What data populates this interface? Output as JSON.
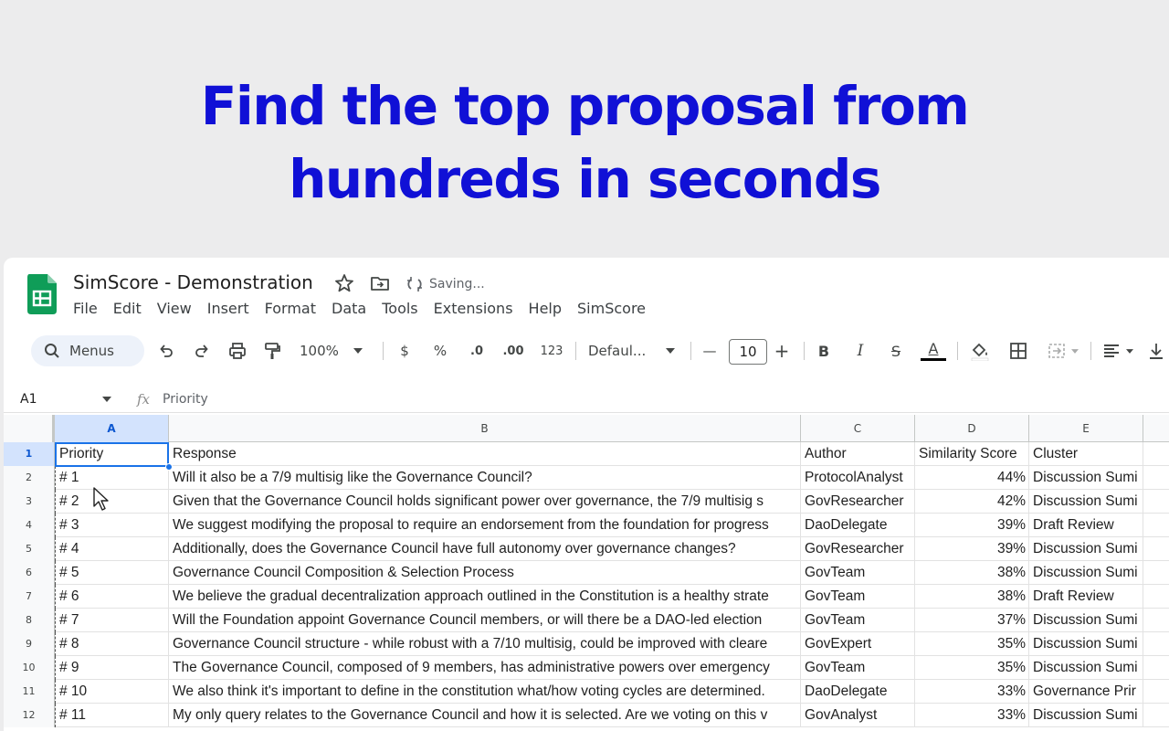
{
  "hero": {
    "line1": "Find the top proposal from",
    "line2": "hundreds in seconds"
  },
  "app": {
    "title": "SimScore - Demonstration",
    "saving_status": "Saving...",
    "icons": [
      "sheets-logo-icon",
      "star-icon",
      "move-to-folder-icon",
      "sync-icon"
    ],
    "menu": [
      "File",
      "Edit",
      "View",
      "Insert",
      "Format",
      "Data",
      "Tools",
      "Extensions",
      "Help",
      "SimScore"
    ]
  },
  "toolbar": {
    "search_label": "Menus",
    "zoom": "100%",
    "currency": "$",
    "percent": "%",
    "decrease_decimal": ".0",
    "increase_decimal": ".00",
    "number_format": "123",
    "font": "Defaul...",
    "font_size": "10",
    "minus": "—",
    "plus": "+",
    "bold": "B",
    "italic": "I",
    "strikethrough": "S",
    "text_color": "A"
  },
  "formula_bar": {
    "cell_ref": "A1",
    "fx": "fx",
    "value": "Priority"
  },
  "columns": [
    "A",
    "B",
    "C",
    "D",
    "E"
  ],
  "rows": [
    {
      "num": "1",
      "priority": "Priority",
      "response": "Response",
      "author": "Author",
      "score": "Similarity Score",
      "cluster": "Cluster"
    },
    {
      "num": "2",
      "priority": "# 1",
      "response": "Will it also be a 7/9 multisig like the Governance Council?",
      "author": "ProtocolAnalyst",
      "score": "44%",
      "cluster": "Discussion Sumi"
    },
    {
      "num": "3",
      "priority": "# 2",
      "response": "Given that the Governance Council holds significant power over governance, the 7/9 multisig s",
      "author": "GovResearcher",
      "score": "42%",
      "cluster": "Discussion Sumi"
    },
    {
      "num": "4",
      "priority": "# 3",
      "response": "We suggest modifying the proposal to require an endorsement from the foundation for progress",
      "author": "DaoDelegate",
      "score": "39%",
      "cluster": "Draft Review"
    },
    {
      "num": "5",
      "priority": "# 4",
      "response": "Additionally, does the Governance Council have full autonomy over governance changes?",
      "author": "GovResearcher",
      "score": "39%",
      "cluster": "Discussion Sumi"
    },
    {
      "num": "6",
      "priority": "# 5",
      "response": "Governance Council Composition & Selection Process",
      "author": "GovTeam",
      "score": "38%",
      "cluster": "Discussion Sumi"
    },
    {
      "num": "7",
      "priority": "# 6",
      "response": "We believe the gradual decentralization approach outlined in the Constitution is a healthy strate",
      "author": "GovTeam",
      "score": "38%",
      "cluster": "Draft Review"
    },
    {
      "num": "8",
      "priority": "# 7",
      "response": "Will the Foundation appoint Governance Council members, or will there be a DAO-led election",
      "author": "GovTeam",
      "score": "37%",
      "cluster": "Discussion Sumi"
    },
    {
      "num": "9",
      "priority": "# 8",
      "response": "Governance Council structure - while robust with a 7/10 multisig, could be improved with cleare",
      "author": "GovExpert",
      "score": "35%",
      "cluster": "Discussion Sumi"
    },
    {
      "num": "10",
      "priority": "# 9",
      "response": "The Governance Council, composed of 9 members, has administrative powers over emergency",
      "author": "GovTeam",
      "score": "35%",
      "cluster": "Discussion Sumi"
    },
    {
      "num": "11",
      "priority": "# 10",
      "response": "We also think it's important to define in the constitution what/how voting cycles are determined.",
      "author": "DaoDelegate",
      "score": "33%",
      "cluster": "Governance Prir"
    },
    {
      "num": "12",
      "priority": "# 11",
      "response": "My only query relates to the Governance Council and how it is selected. Are we voting on this v",
      "author": "GovAnalyst",
      "score": "33%",
      "cluster": "Discussion Sumi"
    }
  ],
  "colors": {
    "hero_text": "#1010d6",
    "hero_bg": "#ececed",
    "selection": "#1a73e8",
    "sheets_green": "#0f9d58"
  }
}
